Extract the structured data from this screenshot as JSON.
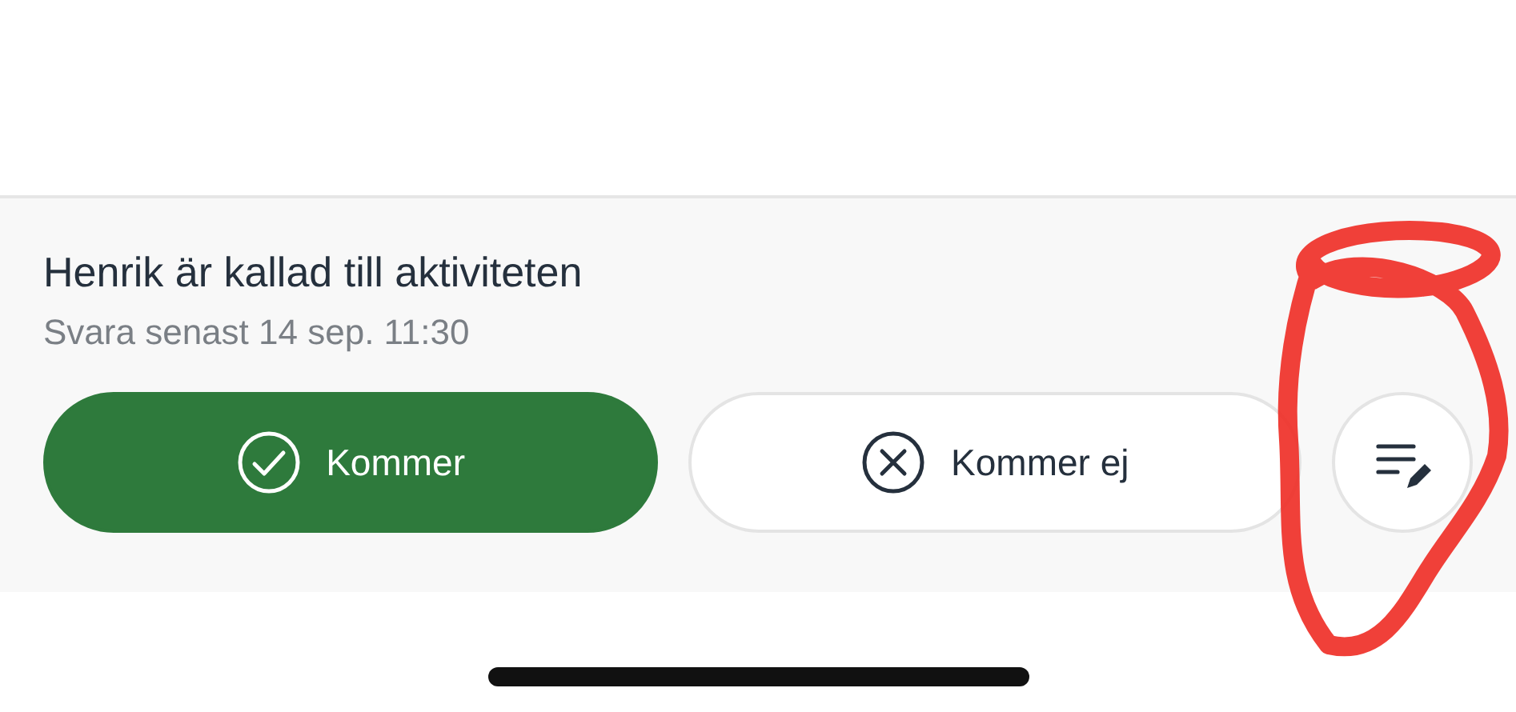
{
  "invitation": {
    "title": "Henrik är kallad till aktiviteten",
    "deadline": "Svara senast 14 sep. 11:30"
  },
  "actions": [
    {
      "kind": "accept",
      "label": "Kommer"
    },
    {
      "kind": "decline",
      "label": "Kommer ej"
    },
    {
      "kind": "note"
    }
  ]
}
